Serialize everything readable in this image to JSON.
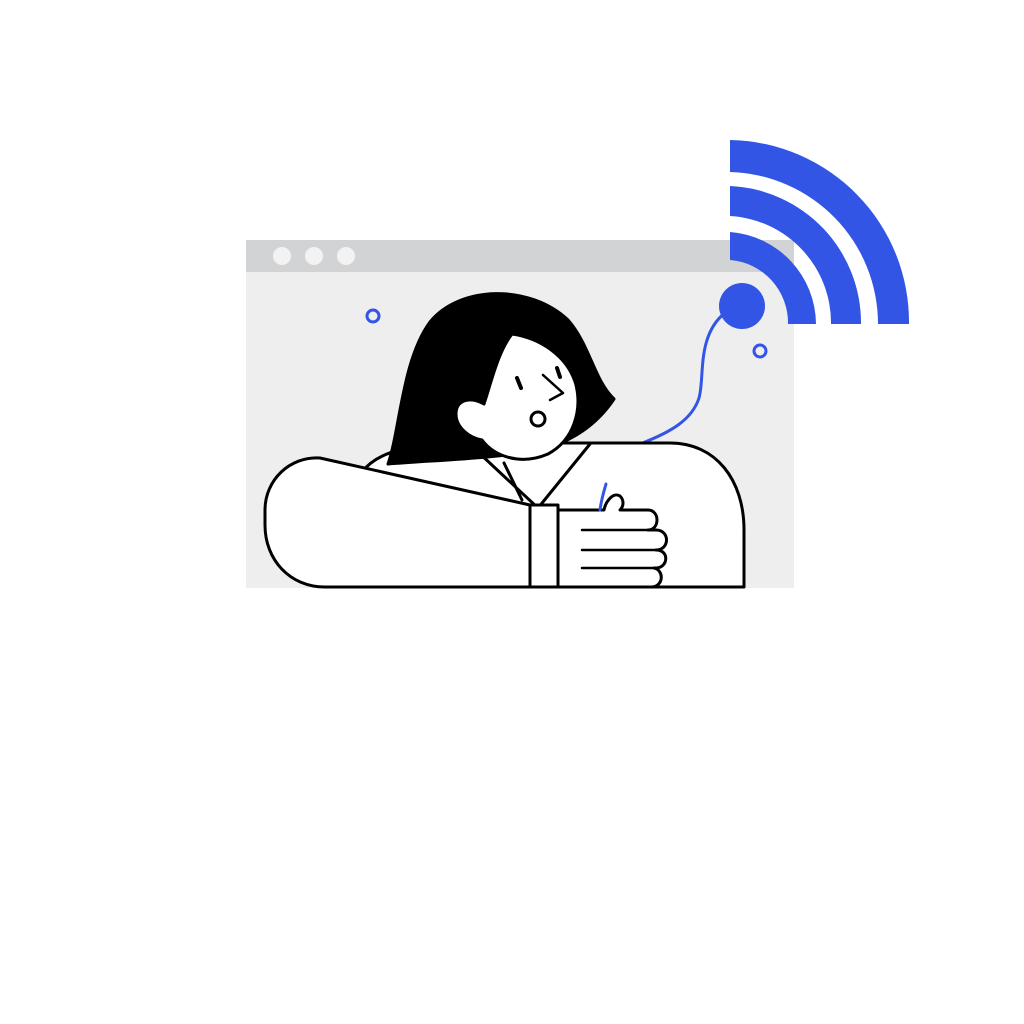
{
  "illustration": {
    "subject": "person-in-browser-window-with-wifi-signal",
    "window": {
      "controls": [
        "dot",
        "dot",
        "dot"
      ]
    },
    "icons": [
      "wifi-icon",
      "browser-window-icon"
    ],
    "colors": {
      "accent": "#3355E6",
      "window_bar": "#D2D3D5",
      "window_body": "#EEEEEE",
      "window_dots": "#F3F3F3",
      "outline": "#000000",
      "hair": "#000000",
      "skin_and_clothes": "#FFFFFF",
      "background": "#FFFFFF"
    }
  }
}
